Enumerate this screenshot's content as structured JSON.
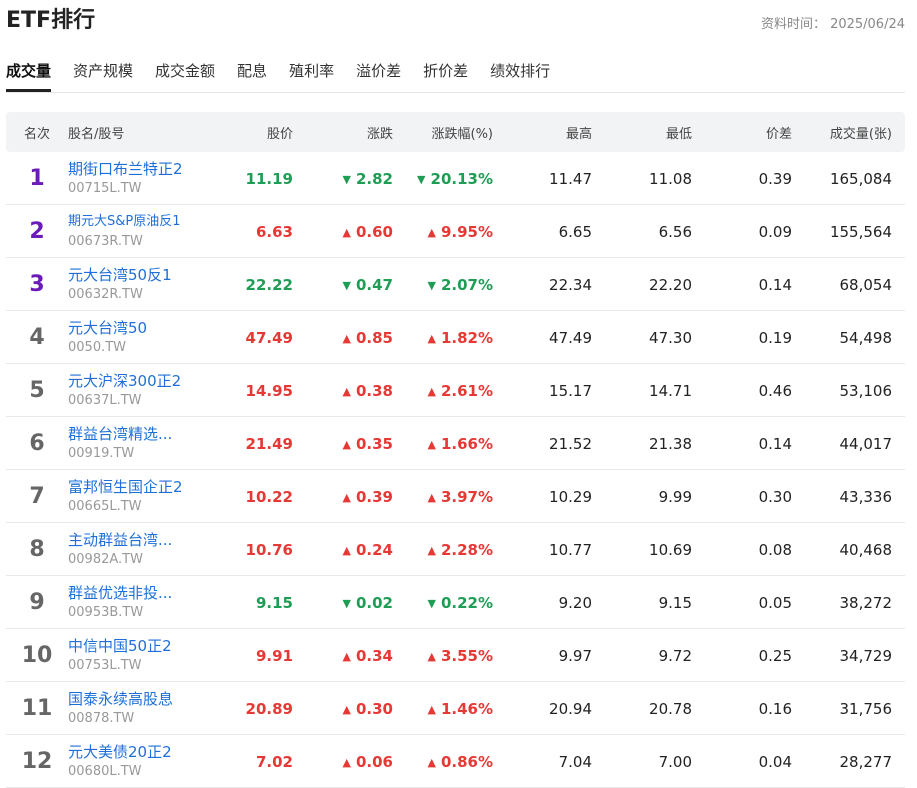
{
  "page": {
    "title": "ETF排行",
    "date_label": "资料时间：",
    "date_value": "2025/06/24"
  },
  "tabs": [
    {
      "label": "成交量",
      "active": true
    },
    {
      "label": "资产规模",
      "active": false
    },
    {
      "label": "成交金额",
      "active": false
    },
    {
      "label": "配息",
      "active": false
    },
    {
      "label": "殖利率",
      "active": false
    },
    {
      "label": "溢价差",
      "active": false
    },
    {
      "label": "折价差",
      "active": false
    },
    {
      "label": "绩效排行",
      "active": false
    }
  ],
  "columns": {
    "rank": "名次",
    "name": "股名/股号",
    "price": "股价",
    "change": "涨跌",
    "pct": "涨跌幅(%)",
    "high": "最高",
    "low": "最低",
    "diff": "价差",
    "volume": "成交量(张)"
  },
  "colors": {
    "up": "#e53935",
    "down": "#1f9d55",
    "rank_top": "#6a1bb8",
    "link": "#1e6fd9"
  },
  "icons": {
    "up": "triangle-up-icon",
    "down": "triangle-down-icon"
  },
  "rows": [
    {
      "rank": "1",
      "name": "期街口布兰特正2",
      "code": "00715L.TW",
      "price": "11.19",
      "dir": "down",
      "change": "2.82",
      "pct": "20.13%",
      "high": "11.47",
      "low": "11.08",
      "diff": "0.39",
      "volume": "165,084"
    },
    {
      "rank": "2",
      "name": "期元大S&P原油反1",
      "code": "00673R.TW",
      "price": "6.63",
      "dir": "up",
      "change": "0.60",
      "pct": "9.95%",
      "high": "6.65",
      "low": "6.56",
      "diff": "0.09",
      "volume": "155,564"
    },
    {
      "rank": "3",
      "name": "元大台湾50反1",
      "code": "00632R.TW",
      "price": "22.22",
      "dir": "down",
      "change": "0.47",
      "pct": "2.07%",
      "high": "22.34",
      "low": "22.20",
      "diff": "0.14",
      "volume": "68,054"
    },
    {
      "rank": "4",
      "name": "元大台湾50",
      "code": "0050.TW",
      "price": "47.49",
      "dir": "up",
      "change": "0.85",
      "pct": "1.82%",
      "high": "47.49",
      "low": "47.30",
      "diff": "0.19",
      "volume": "54,498"
    },
    {
      "rank": "5",
      "name": "元大沪深300正2",
      "code": "00637L.TW",
      "price": "14.95",
      "dir": "up",
      "change": "0.38",
      "pct": "2.61%",
      "high": "15.17",
      "low": "14.71",
      "diff": "0.46",
      "volume": "53,106"
    },
    {
      "rank": "6",
      "name": "群益台湾精选...",
      "code": "00919.TW",
      "price": "21.49",
      "dir": "up",
      "change": "0.35",
      "pct": "1.66%",
      "high": "21.52",
      "low": "21.38",
      "diff": "0.14",
      "volume": "44,017"
    },
    {
      "rank": "7",
      "name": "富邦恒生国企正2",
      "code": "00665L.TW",
      "price": "10.22",
      "dir": "up",
      "change": "0.39",
      "pct": "3.97%",
      "high": "10.29",
      "low": "9.99",
      "diff": "0.30",
      "volume": "43,336"
    },
    {
      "rank": "8",
      "name": "主动群益台湾...",
      "code": "00982A.TW",
      "price": "10.76",
      "dir": "up",
      "change": "0.24",
      "pct": "2.28%",
      "high": "10.77",
      "low": "10.69",
      "diff": "0.08",
      "volume": "40,468"
    },
    {
      "rank": "9",
      "name": "群益优选非投...",
      "code": "00953B.TW",
      "price": "9.15",
      "dir": "down",
      "change": "0.02",
      "pct": "0.22%",
      "high": "9.20",
      "low": "9.15",
      "diff": "0.05",
      "volume": "38,272"
    },
    {
      "rank": "10",
      "name": "中信中国50正2",
      "code": "00753L.TW",
      "price": "9.91",
      "dir": "up",
      "change": "0.34",
      "pct": "3.55%",
      "high": "9.97",
      "low": "9.72",
      "diff": "0.25",
      "volume": "34,729"
    },
    {
      "rank": "11",
      "name": "国泰永续高股息",
      "code": "00878.TW",
      "price": "20.89",
      "dir": "up",
      "change": "0.30",
      "pct": "1.46%",
      "high": "20.94",
      "low": "20.78",
      "diff": "0.16",
      "volume": "31,756"
    },
    {
      "rank": "12",
      "name": "元大美债20正2",
      "code": "00680L.TW",
      "price": "7.02",
      "dir": "up",
      "change": "0.06",
      "pct": "0.86%",
      "high": "7.04",
      "low": "7.00",
      "diff": "0.04",
      "volume": "28,277"
    }
  ]
}
